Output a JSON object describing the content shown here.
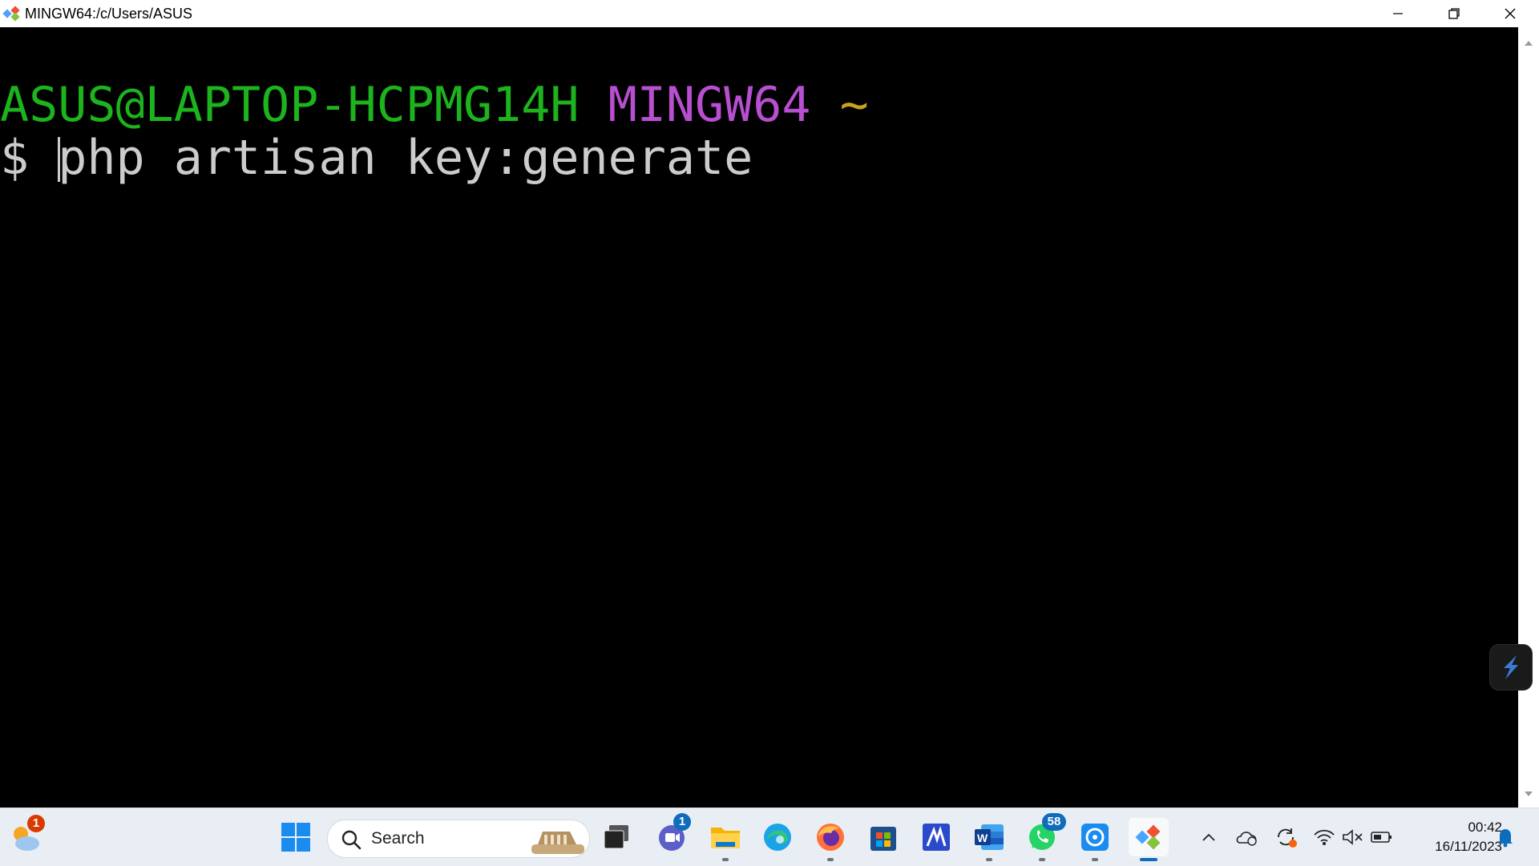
{
  "window": {
    "title": "MINGW64:/c/Users/ASUS"
  },
  "terminal": {
    "prompt_user_host": "ASUS@LAPTOP-HCPMG14H",
    "prompt_system": "MINGW64",
    "prompt_path": "~",
    "prompt_symbol": "$",
    "command": "php artisan key:generate",
    "colors": {
      "user_host": "#1db31d",
      "system": "#b84fd0",
      "path": "#c9a21b",
      "text": "#cccccc"
    }
  },
  "taskbar": {
    "weather_badge": "1",
    "search_placeholder": "Search",
    "teams_badge": "1",
    "whatsapp_badge": "58",
    "clock_time": "00:42",
    "clock_date": "16/11/2023"
  }
}
